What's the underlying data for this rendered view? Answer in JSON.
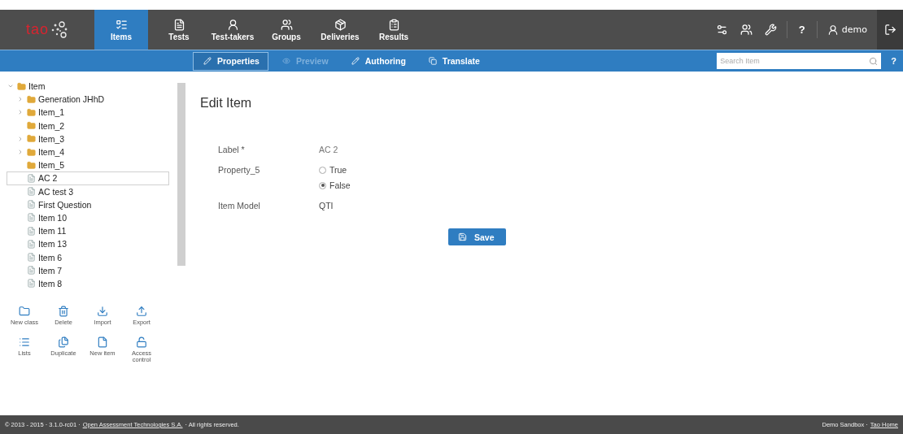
{
  "header": {
    "logo": "tao",
    "nav": [
      {
        "label": "Items",
        "selected": true
      },
      {
        "label": "Tests",
        "selected": false
      },
      {
        "label": "Test-takers",
        "selected": false
      },
      {
        "label": "Groups",
        "selected": false
      },
      {
        "label": "Deliveries",
        "selected": false
      },
      {
        "label": "Results",
        "selected": false
      }
    ],
    "help": "?",
    "user": "demo"
  },
  "subbar": {
    "tabs": [
      {
        "label": "Properties",
        "selected": true,
        "disabled": false
      },
      {
        "label": "Preview",
        "selected": false,
        "disabled": true
      },
      {
        "label": "Authoring",
        "selected": false,
        "disabled": false
      },
      {
        "label": "Translate",
        "selected": false,
        "disabled": false
      }
    ],
    "search": {
      "placeholder": "Search Item"
    },
    "help": "?"
  },
  "tree": {
    "label": "Item",
    "expanded": true,
    "children": [
      {
        "label": "Generation JHhD",
        "kind": "folder",
        "expandable": true,
        "selected": false
      },
      {
        "label": "Item_1",
        "kind": "folder",
        "expandable": true,
        "selected": false
      },
      {
        "label": "Item_2",
        "kind": "folder",
        "expandable": false,
        "selected": false
      },
      {
        "label": "Item_3",
        "kind": "folder",
        "expandable": true,
        "selected": false
      },
      {
        "label": "Item_4",
        "kind": "folder",
        "expandable": true,
        "selected": false
      },
      {
        "label": "Item_5",
        "kind": "folder",
        "expandable": false,
        "selected": false
      },
      {
        "label": "AC 2",
        "kind": "item",
        "expandable": false,
        "selected": true
      },
      {
        "label": "AC test 3",
        "kind": "item",
        "expandable": false,
        "selected": false
      },
      {
        "label": "First Question",
        "kind": "item",
        "expandable": false,
        "selected": false
      },
      {
        "label": "Item 10",
        "kind": "item",
        "expandable": false,
        "selected": false
      },
      {
        "label": "Item 11",
        "kind": "item",
        "expandable": false,
        "selected": false
      },
      {
        "label": "Item 13",
        "kind": "item",
        "expandable": false,
        "selected": false
      },
      {
        "label": "Item 6",
        "kind": "item",
        "expandable": false,
        "selected": false
      },
      {
        "label": "Item 7",
        "kind": "item",
        "expandable": false,
        "selected": false
      },
      {
        "label": "Item 8",
        "kind": "item",
        "expandable": false,
        "selected": false
      }
    ]
  },
  "actions": [
    "New class",
    "Delete",
    "Import",
    "Export",
    "Lists",
    "Duplicate",
    "New item",
    "Access control"
  ],
  "form": {
    "title": "Edit Item",
    "fields": [
      {
        "kind": "text",
        "label": "Label *",
        "value": "AC 2"
      },
      {
        "kind": "radio",
        "label": "Property_5",
        "options": [
          {
            "label": "True",
            "selected": false
          },
          {
            "label": "False",
            "selected": true
          }
        ]
      },
      {
        "kind": "static",
        "label": "Item Model",
        "value": "QTI"
      }
    ],
    "save": "Save"
  },
  "footer": {
    "copyright": "© 2013 - 2015 · 3.1.0-rc01 ·",
    "company_link": "Open Assessment Technologies S.A.",
    "rights": "· All rights reserved.",
    "sandbox": "Demo Sandbox ·",
    "home_link": "Tao Home"
  }
}
